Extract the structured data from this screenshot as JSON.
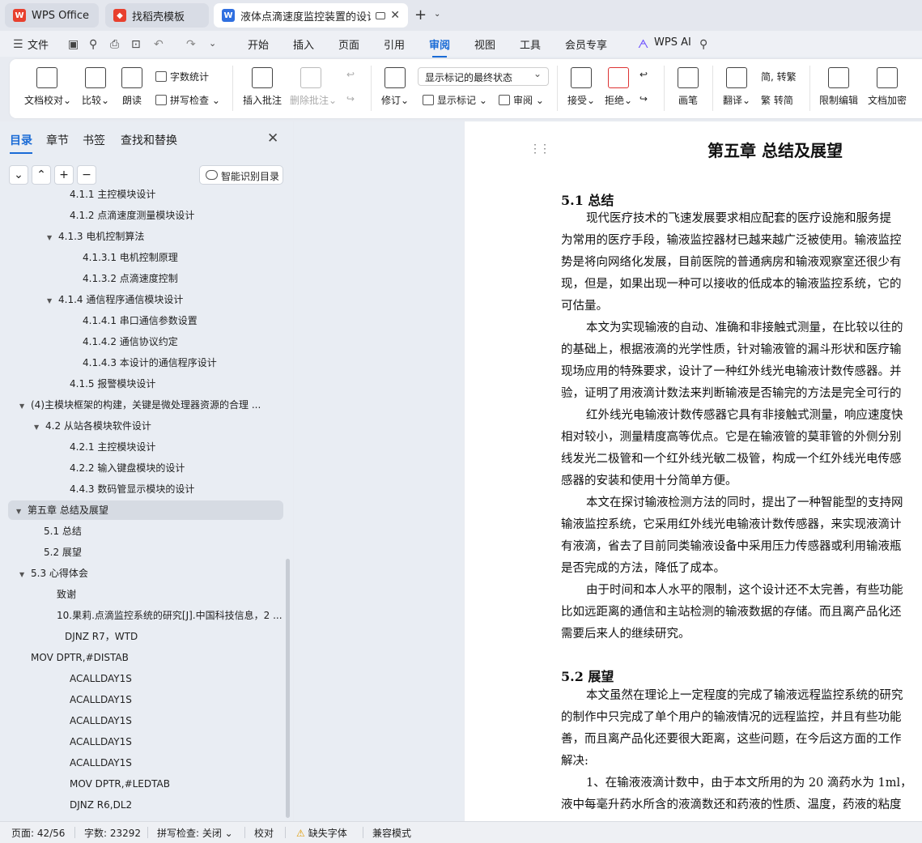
{
  "tabs": [
    {
      "label": "WPS Office",
      "color": "#e8402e"
    },
    {
      "label": "找稻壳模板",
      "color": "#e8402e"
    },
    {
      "label": "液体点滴速度监控装置的设计",
      "color": "#2f6fe0"
    }
  ],
  "menu": [
    "文件",
    "开始",
    "插入",
    "页面",
    "引用",
    "审阅",
    "视图",
    "工具",
    "会员专享",
    "WPS AI"
  ],
  "active_menu": "审阅",
  "ribbon": {
    "doc_check": "文档校对",
    "compare": "比较",
    "read_aloud": "朗读",
    "word_count": "字数统计",
    "spell_check": "拼写检查",
    "insert_comment": "插入批注",
    "delete_comment": "删除批注",
    "revise": "修订",
    "markup_state": "显示标记的最终状态",
    "show_markup": "显示标记",
    "review": "审阅",
    "accept": "接受",
    "reject": "拒绝",
    "pen": "画笔",
    "translate": "翻译",
    "to_traditional": "转繁",
    "to_simplified": "转简",
    "restrict_edit": "限制编辑",
    "encrypt": "文档加密"
  },
  "sidebar": {
    "tabs": [
      "目录",
      "章节",
      "书签",
      "查找和替换"
    ],
    "ai_toc": "智能识别目录",
    "toc": [
      {
        "text": "4.1.1 主控模块设计",
        "arrow": ""
      },
      {
        "text": "4.1.2 点滴速度测量模块设计",
        "arrow": ""
      },
      {
        "text": "4.1.3 电机控制算法",
        "arrow": "▼"
      },
      {
        "text": "4.1.3.1  电机控制原理",
        "arrow": ""
      },
      {
        "text": "4.1.3.2 点滴速度控制",
        "arrow": ""
      },
      {
        "text": "4.1.4 通信程序通信模块设计",
        "arrow": "▼"
      },
      {
        "text": "4.1.4.1 串口通信参数设置",
        "arrow": ""
      },
      {
        "text": "4.1.4.2 通信协议约定",
        "arrow": ""
      },
      {
        "text": "4.1.4.3 本设计的通信程序设计",
        "arrow": ""
      },
      {
        "text": "4.1.5 报警模块设计",
        "arrow": ""
      },
      {
        "text": "(4)主模块框架的构建，关键是微处理器资源的合理 ...",
        "arrow": "▼"
      },
      {
        "text": "4.2  从站各模块软件设计",
        "arrow": "▼"
      },
      {
        "text": "4.2.1  主控模块设计",
        "arrow": ""
      },
      {
        "text": "4.2.2  输入键盘模块的设计",
        "arrow": ""
      },
      {
        "text": "4.4.3    数码管显示模块的设计",
        "arrow": ""
      },
      {
        "text": "第五章    总结及展望",
        "arrow": "▼"
      },
      {
        "text": "5.1 总结",
        "arrow": ""
      },
      {
        "text": "5.2  展望",
        "arrow": ""
      },
      {
        "text": "5.3 心得体会",
        "arrow": "▼"
      },
      {
        "text": "致谢",
        "arrow": ""
      },
      {
        "text": "10.果莉.点滴监控系统的研究[J].中国科技信息，2 ...",
        "arrow": ""
      },
      {
        "text": "DJNZ    R7，WTD",
        "arrow": ""
      },
      {
        "text": "MOV     DPTR,#DISTAB",
        "arrow": ""
      },
      {
        "text": "ACALLDAY1S",
        "arrow": ""
      },
      {
        "text": "ACALLDAY1S",
        "arrow": ""
      },
      {
        "text": "ACALLDAY1S",
        "arrow": ""
      },
      {
        "text": "ACALLDAY1S",
        "arrow": ""
      },
      {
        "text": "ACALLDAY1S",
        "arrow": ""
      },
      {
        "text": "MOV       DPTR,#LEDTAB",
        "arrow": ""
      },
      {
        "text": "DJNZ     R6,DL2",
        "arrow": ""
      }
    ]
  },
  "doc": {
    "chapter": "第五章    总结及展望",
    "h51": "5.1 总结",
    "h52": "5.2  展望",
    "lines": [
      "现代医疗技术的飞速发展要求相应配套的医疗设施和服务提",
      "为常用的医疗手段，输液监控器材已越来越广泛被使用。输液监控",
      "势是将向网络化发展，目前医院的普通病房和输液观察室还很少有",
      "现，但是，如果出现一种可以接收的低成本的输液监控系统，它的",
      "可估量。",
      "本文为实现输液的自动、准确和非接触式测量，在比较以往的",
      "的基础上，根据液滴的光学性质，针对输液管的漏斗形状和医疗输",
      "现场应用的特殊要求，设计了一种红外线光电输液计数传感器。并",
      "验，证明了用液滴计数法来判断输液是否输完的方法是完全可行的",
      "红外线光电输液计数传感器它具有非接触式测量，响应速度快",
      "相对较小，测量精度高等优点。它是在输液管的莫菲管的外侧分别",
      "线发光二极管和一个红外线光敏二极管，构成一个红外线光电传感",
      "感器的安装和使用十分简单方便。",
      "本文在探讨输液检测方法的同时，提出了一种智能型的支持网",
      "输液监控系统，它采用红外线光电输液计数传感器，来实现液滴计",
      "有液滴，省去了目前同类输液设备中采用压力传感器或利用输液瓶",
      "是否完成的方法，降低了成本。",
      "由于时间和本人水平的限制，这个设计还不太完善，有些功能",
      "比如远距离的通信和主站检测的输液数据的存储。而且离产品化还",
      "需要后来人的继续研究。"
    ],
    "lines2": [
      "本文虽然在理论上一定程度的完成了输液远程监控系统的研究",
      "的制作中只完成了单个用户的输液情况的远程监控，并且有些功能",
      "善，而且离产品化还要很大距离，这些问题，在今后这方面的工作",
      "解决:",
      "1、在输液液滴计数中，由于本文所用的为 20 滴药水为 1ml，",
      "液中每毫升药水所含的液滴数还和药液的性质、温度，药液的粘度"
    ]
  },
  "status": {
    "page": "页面: 42/56",
    "words": "字数: 23292",
    "spell": "拼写检查: 关闭",
    "proof": "校对",
    "missing_font": "缺失字体",
    "compat": "兼容模式"
  }
}
